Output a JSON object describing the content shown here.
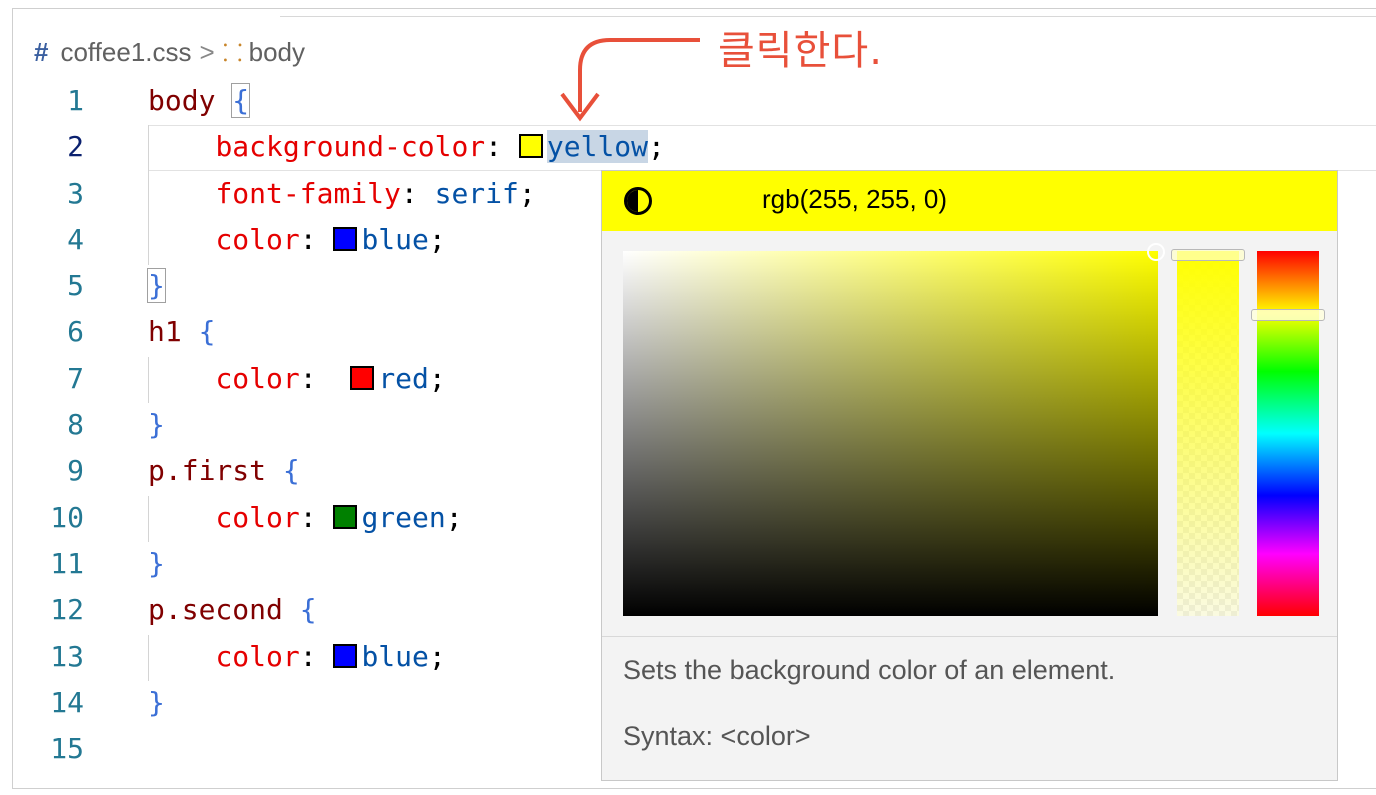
{
  "breadcrumb": {
    "file": "coffee1.css",
    "separator": ">",
    "symbol": "body"
  },
  "annotation": "클릭한다.",
  "lines": [
    {
      "n": "1",
      "sel": "body ",
      "brace": "{"
    },
    {
      "n": "2",
      "prop": "background-color",
      "val": "yellow"
    },
    {
      "n": "3",
      "prop": "font-family",
      "val": "serif"
    },
    {
      "n": "4",
      "prop": "color",
      "val": "blue"
    },
    {
      "n": "5",
      "brace": "}"
    },
    {
      "n": "6",
      "sel": "h1 ",
      "brace": "{"
    },
    {
      "n": "7",
      "prop": "color",
      "val": "red"
    },
    {
      "n": "8",
      "brace": "}"
    },
    {
      "n": "9",
      "sel": "p.first ",
      "brace": "{"
    },
    {
      "n": "10",
      "prop": "color",
      "val": "green"
    },
    {
      "n": "11",
      "brace": "}"
    },
    {
      "n": "12",
      "sel": "p.second ",
      "brace": "{"
    },
    {
      "n": "13",
      "prop": "color",
      "val": "blue"
    },
    {
      "n": "14",
      "brace": "}"
    },
    {
      "n": "15"
    }
  ],
  "colors": {
    "yellow": "#ffff00",
    "blue": "#0000ff",
    "red": "#ff0000",
    "green": "#008000"
  },
  "picker": {
    "value": "rgb(255, 255, 0)",
    "description": "Sets the background color of an element.",
    "syntax": "Syntax: <color>"
  }
}
